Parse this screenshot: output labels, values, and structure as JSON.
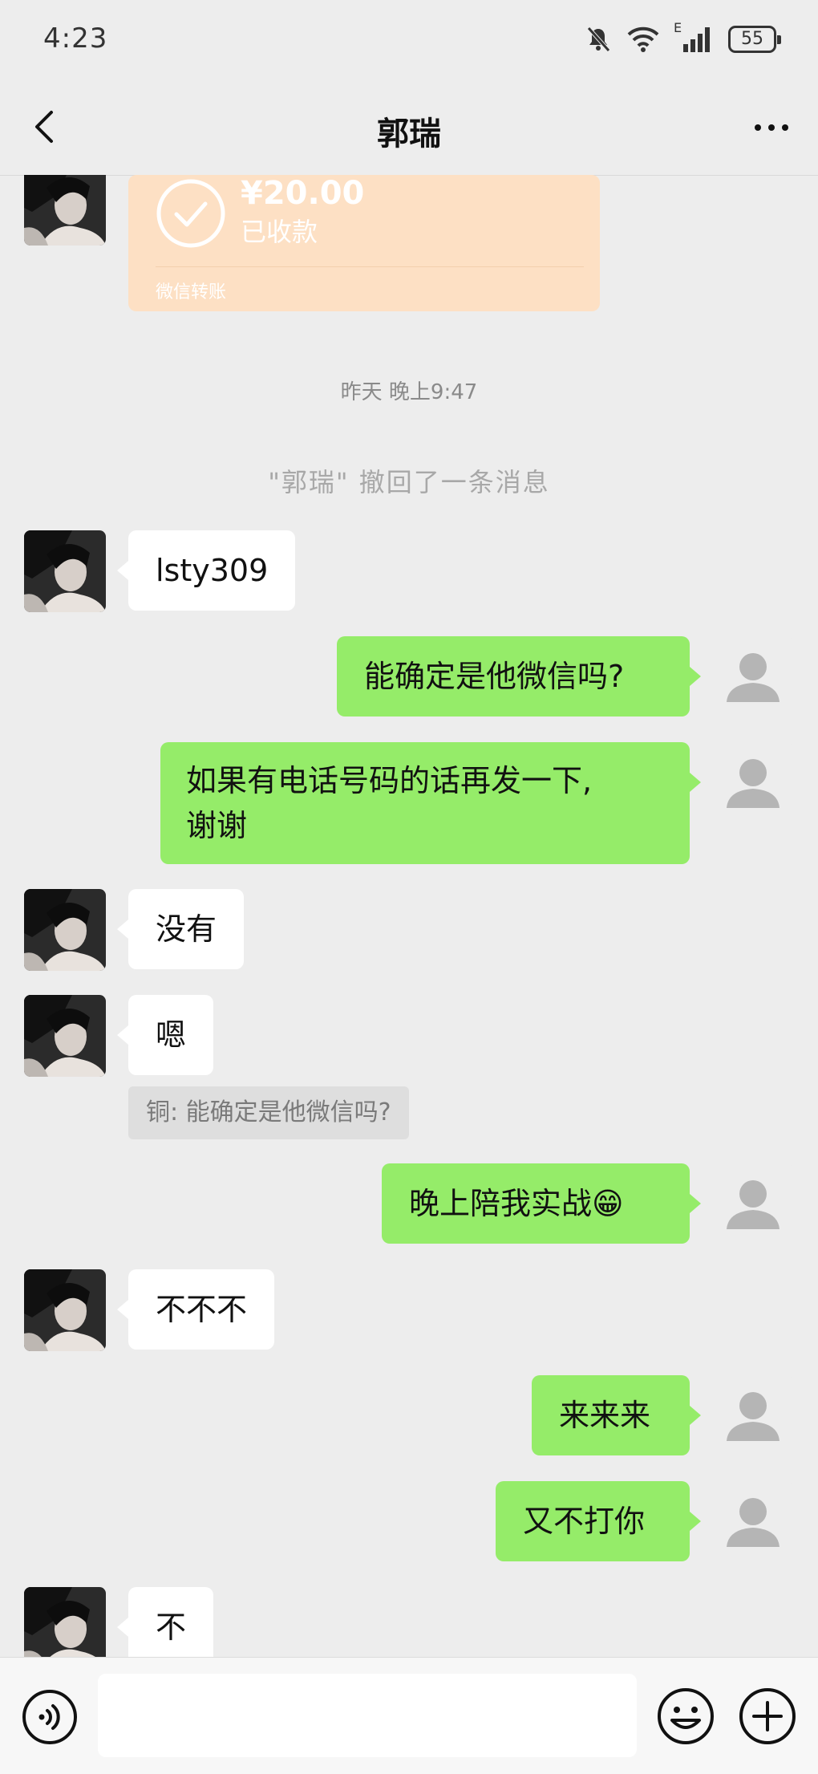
{
  "status_bar": {
    "time": "4:23",
    "network": "E",
    "battery": "55"
  },
  "header": {
    "title": "郭瑞"
  },
  "transfer": {
    "amount": "¥20.00",
    "status": "已收款",
    "footer": "微信转账"
  },
  "timestamp": "昨天 晚上9:47",
  "recall_notice": "\"郭瑞\" 撤回了一条消息",
  "messages": [
    {
      "text": "lsty309"
    },
    {
      "text": "能确定是他微信吗?"
    },
    {
      "line1": "如果有电话号码的话再发一下,",
      "line2": "谢谢"
    },
    {
      "text": "没有"
    },
    {
      "text": "嗯"
    },
    {
      "text": "铜: 能确定是他微信吗?"
    },
    {
      "text": "晚上陪我实战",
      "emoji": "😁"
    },
    {
      "text": "不不不"
    },
    {
      "text": "来来来"
    },
    {
      "text": "又不打你"
    },
    {
      "text": "不"
    }
  ],
  "input": {
    "value": "",
    "placeholder": ""
  },
  "colors": {
    "background": "#ededed",
    "outgoing_bubble": "#95ec69",
    "incoming_bubble": "#ffffff",
    "transfer_card": "#fde0c4"
  },
  "icons": [
    "back-arrow-icon",
    "more-icon",
    "voice-icon",
    "emoji-icon",
    "plus-icon",
    "check-icon",
    "mute-bell-icon",
    "wifi-icon",
    "signal-icon",
    "battery-icon"
  ]
}
